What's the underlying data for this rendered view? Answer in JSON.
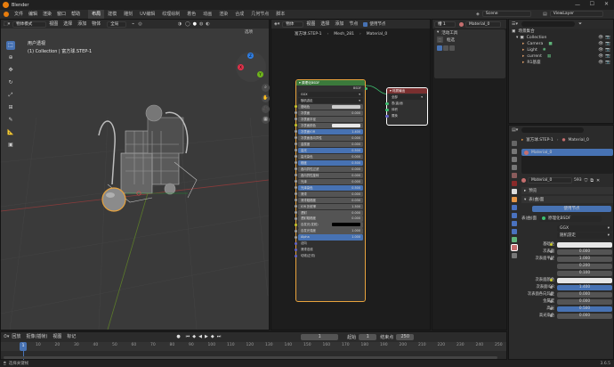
{
  "app": {
    "title": "Blender",
    "version": "3.6.5",
    "status_left": "选择关键帧"
  },
  "menus": [
    "文件",
    "编辑",
    "渲染",
    "窗口",
    "帮助"
  ],
  "workspaces": [
    {
      "label": "布局",
      "active": true
    },
    {
      "label": "建模"
    },
    {
      "label": "雕刻"
    },
    {
      "label": "UV编辑"
    },
    {
      "label": "纹理绘制"
    },
    {
      "label": "着色"
    },
    {
      "label": "动画"
    },
    {
      "label": "渲染"
    },
    {
      "label": "合成"
    },
    {
      "label": "几何节点"
    },
    {
      "label": "脚本"
    }
  ],
  "scene": {
    "name": "Scene",
    "view_layer": "ViewLayer"
  },
  "viewport": {
    "mode": "物体模式",
    "menus": [
      "视图",
      "选择",
      "添加",
      "物体"
    ],
    "global": "全局",
    "info_title": "用户透视",
    "info_sub": "(1) Collection | 富方球.STEP-1",
    "options": "选项"
  },
  "node_editor": {
    "type": "物体",
    "menus": [
      "视图",
      "选择",
      "添加",
      "节点"
    ],
    "use_nodes_label": "使用节点",
    "slot": "槽 1",
    "material": "Material_0",
    "breadcrumb": [
      "富方球.STEP-1",
      "Mesh_281",
      "Material_0"
    ],
    "tools_panel": {
      "title": "活动工具",
      "tool": "框选"
    },
    "bsdf": {
      "title": "原理化BSDF",
      "output_label": "BSDF",
      "dist": "GGX",
      "sss": "随机游走",
      "rows": [
        {
          "label": "基础色",
          "value": ""
        },
        {
          "label": "次表面",
          "value": "0.000"
        },
        {
          "label": "次表面半径",
          "value": ""
        },
        {
          "label": "次表面颜色",
          "value": ""
        },
        {
          "label": "次表面IOR",
          "value": "1.400",
          "blue": true
        },
        {
          "label": "次表面各向异性",
          "value": "0.000"
        },
        {
          "label": "金属度",
          "value": "0.000"
        },
        {
          "label": "高光",
          "value": "0.500",
          "blue": true
        },
        {
          "label": "高光染色",
          "value": "0.000"
        },
        {
          "label": "糙度",
          "value": "0.500",
          "blue": true
        },
        {
          "label": "各向异性过滤",
          "value": "0.000"
        },
        {
          "label": "各向异性旋转",
          "value": "0.000"
        },
        {
          "label": "光泽",
          "value": "0.000"
        },
        {
          "label": "光泽染色",
          "value": "0.500",
          "blue": true
        },
        {
          "label": "清漆",
          "value": "0.000"
        },
        {
          "label": "清漆粗糙度",
          "value": "0.030"
        },
        {
          "label": "IOR 折射率",
          "value": "1.500"
        },
        {
          "label": "透射",
          "value": "0.000"
        },
        {
          "label": "透射粗糙度",
          "value": "0.000"
        },
        {
          "label": "自发光(发射)",
          "value": ""
        },
        {
          "label": "自发光强度",
          "value": "1.000"
        },
        {
          "label": "Alpha",
          "value": "1.000",
          "blue": true
        },
        {
          "label": "法向",
          "value": ""
        },
        {
          "label": "清漆法线",
          "value": ""
        },
        {
          "label": "切线(正切)",
          "value": ""
        }
      ]
    },
    "output_node": {
      "title": "材质输出",
      "target": "全部",
      "sockets": [
        "表(曲)面",
        "体积",
        "置换"
      ]
    }
  },
  "outliner": {
    "title": "场景集合",
    "items": [
      {
        "label": "Collection",
        "depth": 1
      },
      {
        "label": "Camera",
        "depth": 2
      },
      {
        "label": "Light",
        "depth": 2
      },
      {
        "label": "current",
        "depth": 2
      },
      {
        "label": "R1基座",
        "depth": 2
      }
    ]
  },
  "properties": {
    "breadcrumb": [
      "富方球.STEP-1",
      "Material_0"
    ],
    "slot_material": "Material_0",
    "material_field": "Material_0",
    "users": "593",
    "preview_label": "预览",
    "surface_label": "表(曲)面",
    "use_nodes": "使用节点",
    "surface_value": "原理化BSDF",
    "surface_key": "表(曲)面",
    "dist": "GGX",
    "sss": "随机游走",
    "rows": [
      {
        "label": "基础色",
        "value": "",
        "kind": "color"
      },
      {
        "label": "次表面",
        "value": "0.000"
      },
      {
        "label": "次表面半径",
        "value": "1.000"
      },
      {
        "label": "",
        "value": "0.200"
      },
      {
        "label": "",
        "value": "0.100"
      },
      {
        "label": "次表面颜色",
        "value": "",
        "kind": "color"
      },
      {
        "label": "次表面IOR",
        "value": "1.400",
        "blue": true
      },
      {
        "label": "次表面各向异性",
        "value": "0.000"
      },
      {
        "label": "金属度",
        "value": "0.000"
      },
      {
        "label": "高光",
        "value": "0.500",
        "blue": true
      },
      {
        "label": "高光染色",
        "value": "0.000"
      }
    ]
  },
  "timeline": {
    "menus": [
      "回放",
      "抠像(插帧)",
      "视图",
      "标记"
    ],
    "current_frame": "1",
    "start_label": "起始",
    "start": "1",
    "end_label": "结束点",
    "end": "250",
    "ruler": [
      "10",
      "20",
      "30",
      "40",
      "50",
      "60",
      "70",
      "80",
      "90",
      "100",
      "110",
      "120",
      "130",
      "140",
      "150",
      "160",
      "170",
      "180",
      "190",
      "200",
      "210",
      "220",
      "230",
      "240",
      "250"
    ]
  },
  "colors": {
    "accent": "#4772b3",
    "shader_header": "#3b7a3b",
    "output_header": "#7a2f2f",
    "selected_outline": "#e8a33d"
  }
}
